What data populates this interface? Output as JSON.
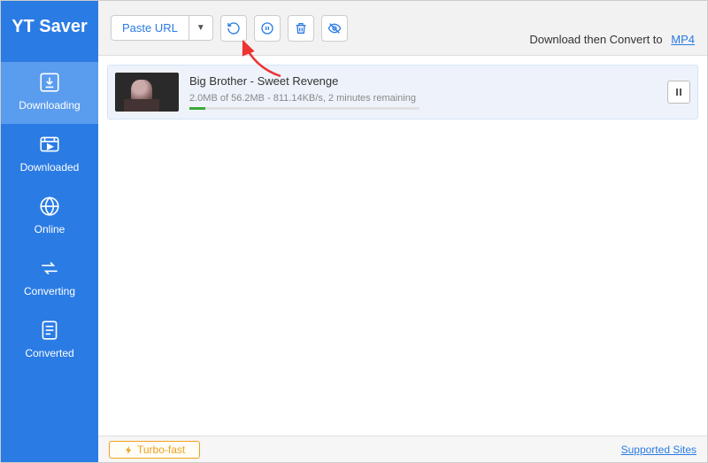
{
  "app_name": "YT Saver",
  "topbar": {
    "paste_label": "Paste URL",
    "convert_text": "Download then Convert to",
    "convert_format": "MP4"
  },
  "sidebar": {
    "items": [
      {
        "label": "Downloading"
      },
      {
        "label": "Downloaded"
      },
      {
        "label": "Online"
      },
      {
        "label": "Converting"
      },
      {
        "label": "Converted"
      }
    ]
  },
  "download": {
    "title": "Big Brother - Sweet Revenge",
    "status": "2.0MB of 56.2MB -  811.14KB/s, 2 minutes remaining"
  },
  "bottom": {
    "turbo_label": "Turbo-fast",
    "supported_label": "Supported Sites"
  }
}
